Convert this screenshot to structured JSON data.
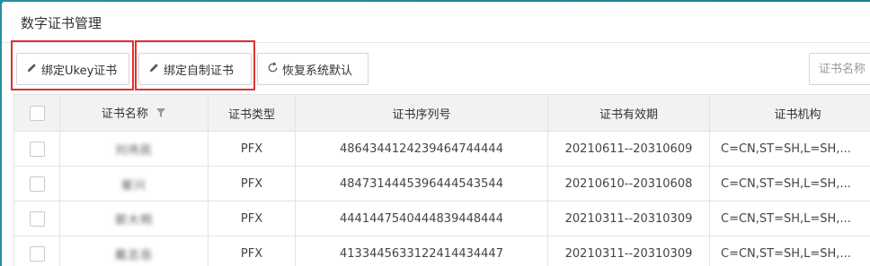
{
  "panel": {
    "title": "数字证书管理"
  },
  "toolbar": {
    "bind_ukey_label": "绑定Ukey证书",
    "bind_self_label": "绑定自制证书",
    "restore_default_label": "恢复系统默认"
  },
  "search": {
    "placeholder": "证书名称"
  },
  "table": {
    "headers": [
      "证书名称",
      "证书类型",
      "证书序列号",
      "证书有效期",
      "证书机构"
    ],
    "rows": [
      {
        "name": "刘伟民",
        "type": "PFX",
        "serial": "4864344124239464744444",
        "validity": "20210611--20310609",
        "issuer": "C=CN,ST=SH,L=SH,..."
      },
      {
        "name": "崔兴",
        "type": "PFX",
        "serial": "4847314445396444543544",
        "validity": "20210610--20310608",
        "issuer": "C=CN,ST=SH,L=SH,..."
      },
      {
        "name": "郭大明",
        "type": "PFX",
        "serial": "4441447540444839448444",
        "validity": "20210311--20310309",
        "issuer": "C=CN,ST=SH,L=SH,..."
      },
      {
        "name": "戴志岳",
        "type": "PFX",
        "serial": "4133445633122414434447",
        "validity": "20210311--20310309",
        "issuer": "C=CN,ST=SH,L=SH,..."
      }
    ]
  }
}
